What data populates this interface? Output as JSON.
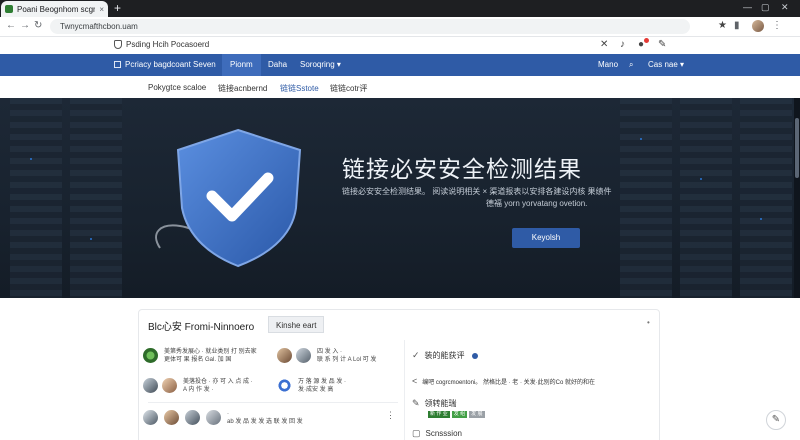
{
  "browser": {
    "tab_title": "Poani Beognhom scgmeroce",
    "tab_close": "×",
    "new_tab": "+",
    "window_controls": [
      "—",
      "▢",
      "✕"
    ],
    "url": "Twnycmafthcbon.uam",
    "nav_back": "←",
    "nav_forward": "→",
    "nav_reload": "↻",
    "bookmark": "★"
  },
  "site_header": {
    "brand": "Psding Hcih Pocasoerd"
  },
  "main_nav": {
    "brand": "Pcriacy bagdcoant Seven",
    "items": [
      "Pionm",
      "Daha",
      "Soroqring"
    ],
    "dropdown_caret": "▾",
    "right_items": [
      "Mano",
      "Cas nae"
    ]
  },
  "sub_nav": {
    "items": [
      "Pokygtce scaloe",
      "链接acnbernd",
      "链链Sstote",
      "链链cotr评"
    ],
    "active_index": 2
  },
  "hero": {
    "title": "链接必安安全检测结果",
    "subtitle_line1": "链接必安安全检测结果。 阅读说明相关 × 渠道报表以安排各建设内核 果绩件",
    "subtitle_line2": "德福 yorn yorvatang ovetion.",
    "button": "Keyolsh"
  },
  "blog": {
    "title": "Blc心安 Fromi-Ninnoero",
    "chip": "Kinshe eart",
    "more": "•",
    "posts": [
      {
        "line1": "美第秀发展心 · 就业类别 打 别去家",
        "line2": "更体可 果 报名 Gal. 加 国"
      },
      {
        "line1": "四 发 入 ·",
        "line2": "联 系 列 计 A Lol 可 发"
      },
      {
        "line1": "美落投仓 · 亦 可 入 点 成 ·",
        "line2": "A 内 作 发 ·"
      },
      {
        "line1": "万 落 源 发 品 发 ·",
        "line2": "发·成安 发 高"
      },
      {
        "line1": "·",
        "line2": "ab 发 品 发 发 选 联 发 回 发"
      }
    ],
    "menu_dots": "⋮"
  },
  "sidebar": {
    "items": [
      {
        "icon": "✓",
        "label": "装的能获评"
      },
      {
        "icon": "<",
        "label": "编吧 cogrcmoentoni。 然格比是 · 老 · 关发·此别的Co 就好的和在"
      },
      {
        "icon": "✎",
        "label": "领转能瑞"
      },
      {
        "icon": "▢",
        "label": "Scnsssion"
      }
    ],
    "tags": [
      "新 作 业",
      "发 组",
      "发 展"
    ]
  },
  "colors": {
    "accent_blue": "#2f5ba6",
    "hero_bg": "#1d2836",
    "tag_green": "#2e7d32"
  },
  "fab_icon": "✎"
}
